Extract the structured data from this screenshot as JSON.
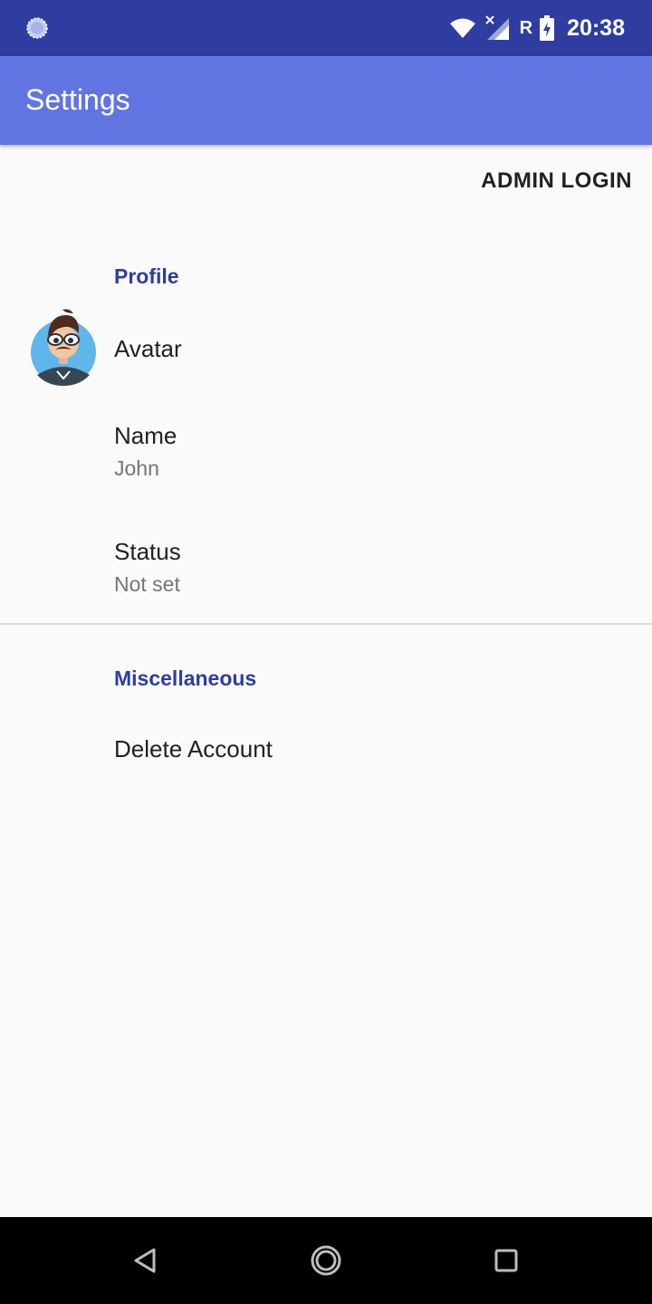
{
  "status_bar": {
    "left_icon": "loading-circle-icon",
    "wifi_icon": "wifi-icon",
    "signal_icon": "signal-no-data-icon",
    "network_label": "R",
    "battery_icon": "battery-charging-icon",
    "time": "20:38"
  },
  "app_bar": {
    "title": "Settings"
  },
  "actions": {
    "admin_login": "ADMIN LOGIN"
  },
  "sections": {
    "profile": {
      "header": "Profile",
      "avatar_label": "Avatar",
      "name_label": "Name",
      "name_value": "John",
      "status_label": "Status",
      "status_value": "Not set"
    },
    "misc": {
      "header": "Miscellaneous",
      "delete_label": "Delete Account"
    }
  },
  "nav_bar": {
    "back_icon": "back-triangle-icon",
    "home_icon": "home-circle-icon",
    "recents_icon": "recents-square-icon"
  },
  "colors": {
    "status_bar": "#2e3d9f",
    "app_bar": "#6175e2",
    "accent": "#2e3d9f",
    "background": "#fafafa"
  }
}
